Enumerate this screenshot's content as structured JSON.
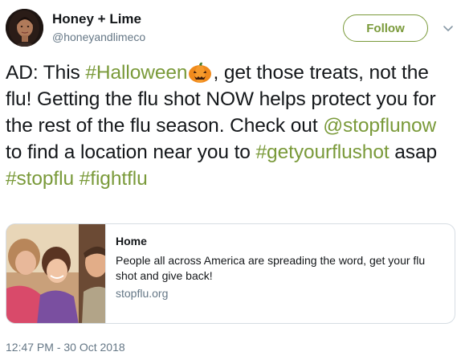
{
  "author": {
    "name": "Honey + Lime",
    "handle": "@honeyandlimeco",
    "avatar_icon": "profile-photo"
  },
  "actions": {
    "follow_label": "Follow",
    "menu_icon": "chevron-down-icon"
  },
  "tweet": {
    "segments": [
      {
        "text": "AD: This ",
        "type": "text"
      },
      {
        "text": "#Halloween",
        "type": "hashtag"
      },
      {
        "text": "",
        "type": "emoji",
        "icon": "pumpkin-emoji"
      },
      {
        "text": ", get those treats, not the flu! Getting the flu shot NOW helps protect you for the rest of the flu season. Check out ",
        "type": "text"
      },
      {
        "text": "@stopflunow",
        "type": "mention"
      },
      {
        "text": " to find a location near you to ",
        "type": "text"
      },
      {
        "text": "#getyourflushot",
        "type": "hashtag"
      },
      {
        "text": " asap ",
        "type": "text"
      },
      {
        "text": "#stopflu",
        "type": "hashtag"
      },
      {
        "text": " ",
        "type": "text"
      },
      {
        "text": "#fightflu",
        "type": "hashtag"
      }
    ]
  },
  "card": {
    "title": "Home",
    "description": "People all across America are spreading the word, get your flu shot and give back!",
    "domain": "stopflu.org",
    "image_icon": "family-photo"
  },
  "timestamp": "12:47 PM - 30 Oct 2018",
  "colors": {
    "link": "#7a9a3a",
    "text": "#14171a",
    "secondary": "#657786",
    "border": "#d6dde3"
  }
}
